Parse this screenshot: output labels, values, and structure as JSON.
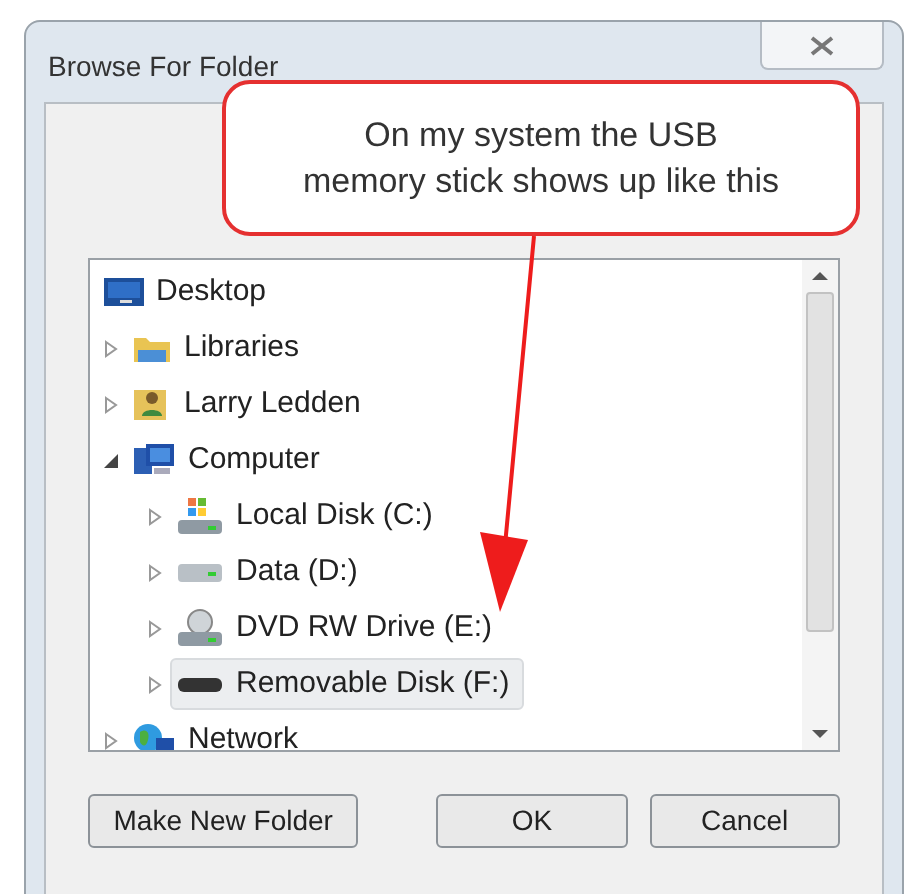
{
  "window": {
    "title": "Browse For Folder"
  },
  "callout": {
    "text": "On my system the USB memory stick shows up like this"
  },
  "tree": [
    {
      "label": "Desktop",
      "kind": "desktop",
      "selected": false,
      "children": [
        {
          "label": "Libraries",
          "kind": "libraries",
          "expanded": false,
          "selected": false
        },
        {
          "label": "Larry Ledden",
          "kind": "user",
          "expanded": false,
          "selected": false
        },
        {
          "label": "Computer",
          "kind": "computer",
          "expanded": true,
          "selected": false,
          "children": [
            {
              "label": "Local Disk (C:)",
              "kind": "system",
              "expanded": false,
              "selected": false
            },
            {
              "label": "Data (D:)",
              "kind": "disk",
              "expanded": false,
              "selected": false
            },
            {
              "label": "DVD RW Drive (E:)",
              "kind": "dvd",
              "expanded": false,
              "selected": false
            },
            {
              "label": "Removable Disk (F:)",
              "kind": "removable",
              "expanded": false,
              "selected": true
            }
          ]
        },
        {
          "label": "Network",
          "kind": "network",
          "expanded": false,
          "selected": false
        }
      ]
    }
  ],
  "buttons": [
    {
      "label": "Make New Folder"
    },
    {
      "label": "OK"
    },
    {
      "label": "Cancel"
    }
  ]
}
